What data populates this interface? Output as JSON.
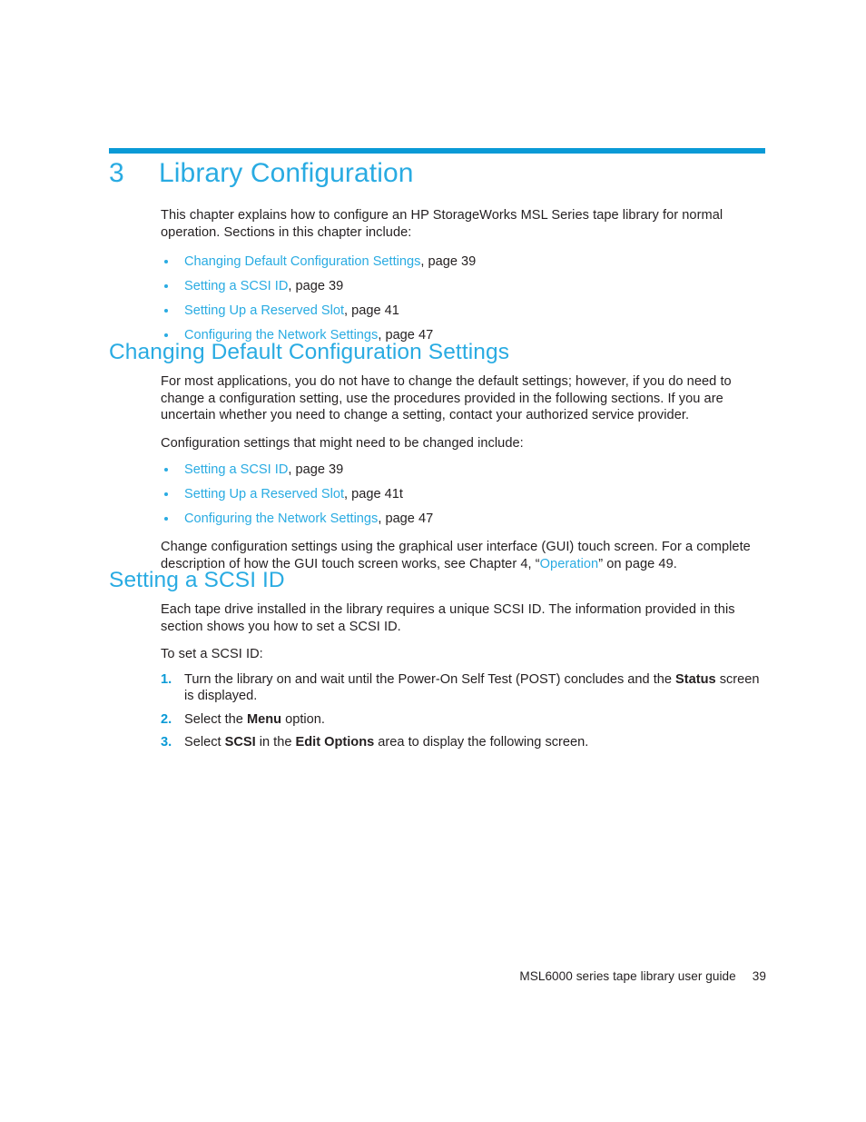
{
  "document": {
    "chapter_number": "3",
    "chapter_title": "Library Configuration"
  },
  "intro": {
    "paragraph": "This chapter explains how to configure an HP StorageWorks MSL Series tape library for normal operation. Sections in this chapter include:",
    "links": [
      {
        "text": "Changing Default Configuration Settings",
        "page_ref": ", page 39"
      },
      {
        "text": "Setting a SCSI ID",
        "page_ref": ", page 39"
      },
      {
        "text": "Setting Up a Reserved Slot",
        "page_ref": ", page 41"
      },
      {
        "text": "Configuring the Network Settings",
        "page_ref": ", page 47"
      }
    ]
  },
  "section_changing_defaults": {
    "heading": "Changing Default Configuration Settings",
    "paragraph_1": "For most applications, you do not have to change the default settings; however, if you do need to change a configuration setting, use the procedures provided in the following sections. If you are uncertain whether you need to change a setting, contact your authorized service provider.",
    "paragraph_2": "Configuration settings that might need to be changed include:",
    "links": [
      {
        "text": "Setting a SCSI ID",
        "page_ref": ", page 39"
      },
      {
        "text": "Setting Up a Reserved Slot",
        "page_ref": ", page 41t"
      },
      {
        "text": "Configuring the Network Settings",
        "page_ref": ", page 47"
      }
    ],
    "paragraph_3_before": "Change configuration settings using the graphical user interface (GUI) touch screen. For a complete description of how the GUI touch screen works, see Chapter 4, “",
    "paragraph_3_link": "Operation",
    "paragraph_3_after": "” on page 49."
  },
  "section_scsi_id": {
    "heading": "Setting a SCSI ID",
    "paragraph_1": "Each tape drive installed in the library requires a unique SCSI ID. The information provided in this section shows you how to set a SCSI ID.",
    "paragraph_2": "To set a SCSI ID:",
    "steps": [
      {
        "number": "1.",
        "part_1": "Turn the library on and wait until the Power-On Self Test (POST) concludes and the ",
        "bold_1": "Status",
        "part_2": " screen is displayed.",
        "bold_2": "",
        "part_3": ""
      },
      {
        "number": "2.",
        "part_1": "Select the ",
        "bold_1": "Menu",
        "part_2": " option.",
        "bold_2": "",
        "part_3": ""
      },
      {
        "number": "3.",
        "part_1": "Select ",
        "bold_1": "SCSI",
        "part_2": " in the ",
        "bold_2": "Edit Options",
        "part_3": " area to display the following screen."
      }
    ]
  },
  "footer": {
    "guide_name": "MSL6000 series tape library user guide",
    "page_number": "39"
  },
  "colors": {
    "accent_rule": "#0a9ad6",
    "heading": "#29abe2",
    "link": "#29abe2",
    "body_text": "#231f20"
  }
}
